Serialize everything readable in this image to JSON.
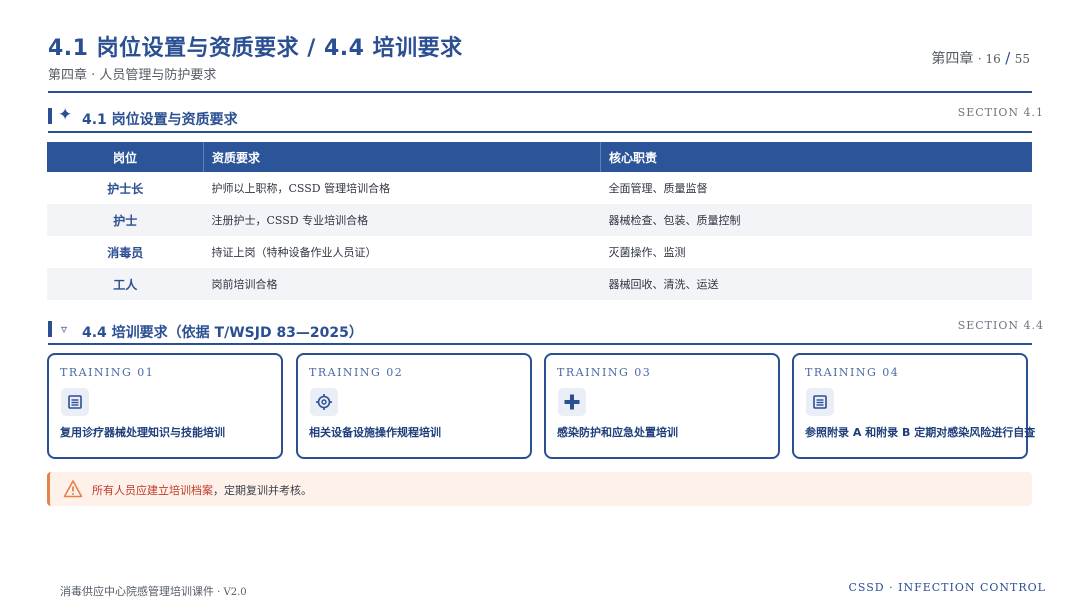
{
  "header": {
    "title": "4.1 岗位设置与资质要求 / 4.4 培训要求",
    "subtitle": "第四章 · 人员管理与防护要求",
    "chapter_label": "第四章",
    "page_current": "16",
    "page_sep": "/",
    "page_total": "55"
  },
  "section1": {
    "icon": "sparkle-icon",
    "title": "4.1 岗位设置与资质要求",
    "tag": "SECTION 4.1"
  },
  "table": {
    "headers": [
      "岗位",
      "资质要求",
      "核心职责"
    ],
    "rows": [
      [
        "护士长",
        "护师以上职称，CSSD 管理培训合格",
        "全面管理、质量监督"
      ],
      [
        "护士",
        "注册护士，CSSD 专业培训合格",
        "器械检查、包装、质量控制"
      ],
      [
        "消毒员",
        "持证上岗（特种设备作业人员证）",
        "灭菌操作、监测"
      ],
      [
        "工人",
        "岗前培训合格",
        "器械回收、清洗、运送"
      ]
    ]
  },
  "section2": {
    "icon": "triangle-down-icon",
    "title": "4.4 培训要求（依据 T/WSJD 83—2025）",
    "tag": "SECTION 4.4"
  },
  "trainings": [
    {
      "caption": "TRAINING 01",
      "icon": "list-icon",
      "label": "复用诊疗器械处理知识与技能培训"
    },
    {
      "caption": "TRAINING 02",
      "icon": "gear-icon",
      "label": "相关设备设施操作规程培训"
    },
    {
      "caption": "TRAINING 03",
      "icon": "plus-icon",
      "label": "感染防护和应急处置培训"
    },
    {
      "caption": "TRAINING 04",
      "icon": "list-icon",
      "label": "参照附录 A 和附录 B 定期对感染风险进行自查"
    }
  ],
  "note": {
    "icon": "warning-icon",
    "highlight": "所有人员应建立培训档案",
    "rest": "，定期复训并考核。"
  },
  "footer": {
    "left": "消毒供应中心院感管理培训课件",
    "version": "V2.0",
    "right": "CSSD · INFECTION CONTROL"
  },
  "colors": {
    "primary": "#2b4f93",
    "warning": "#e3824a",
    "note_bg": "#fdf1ea"
  }
}
